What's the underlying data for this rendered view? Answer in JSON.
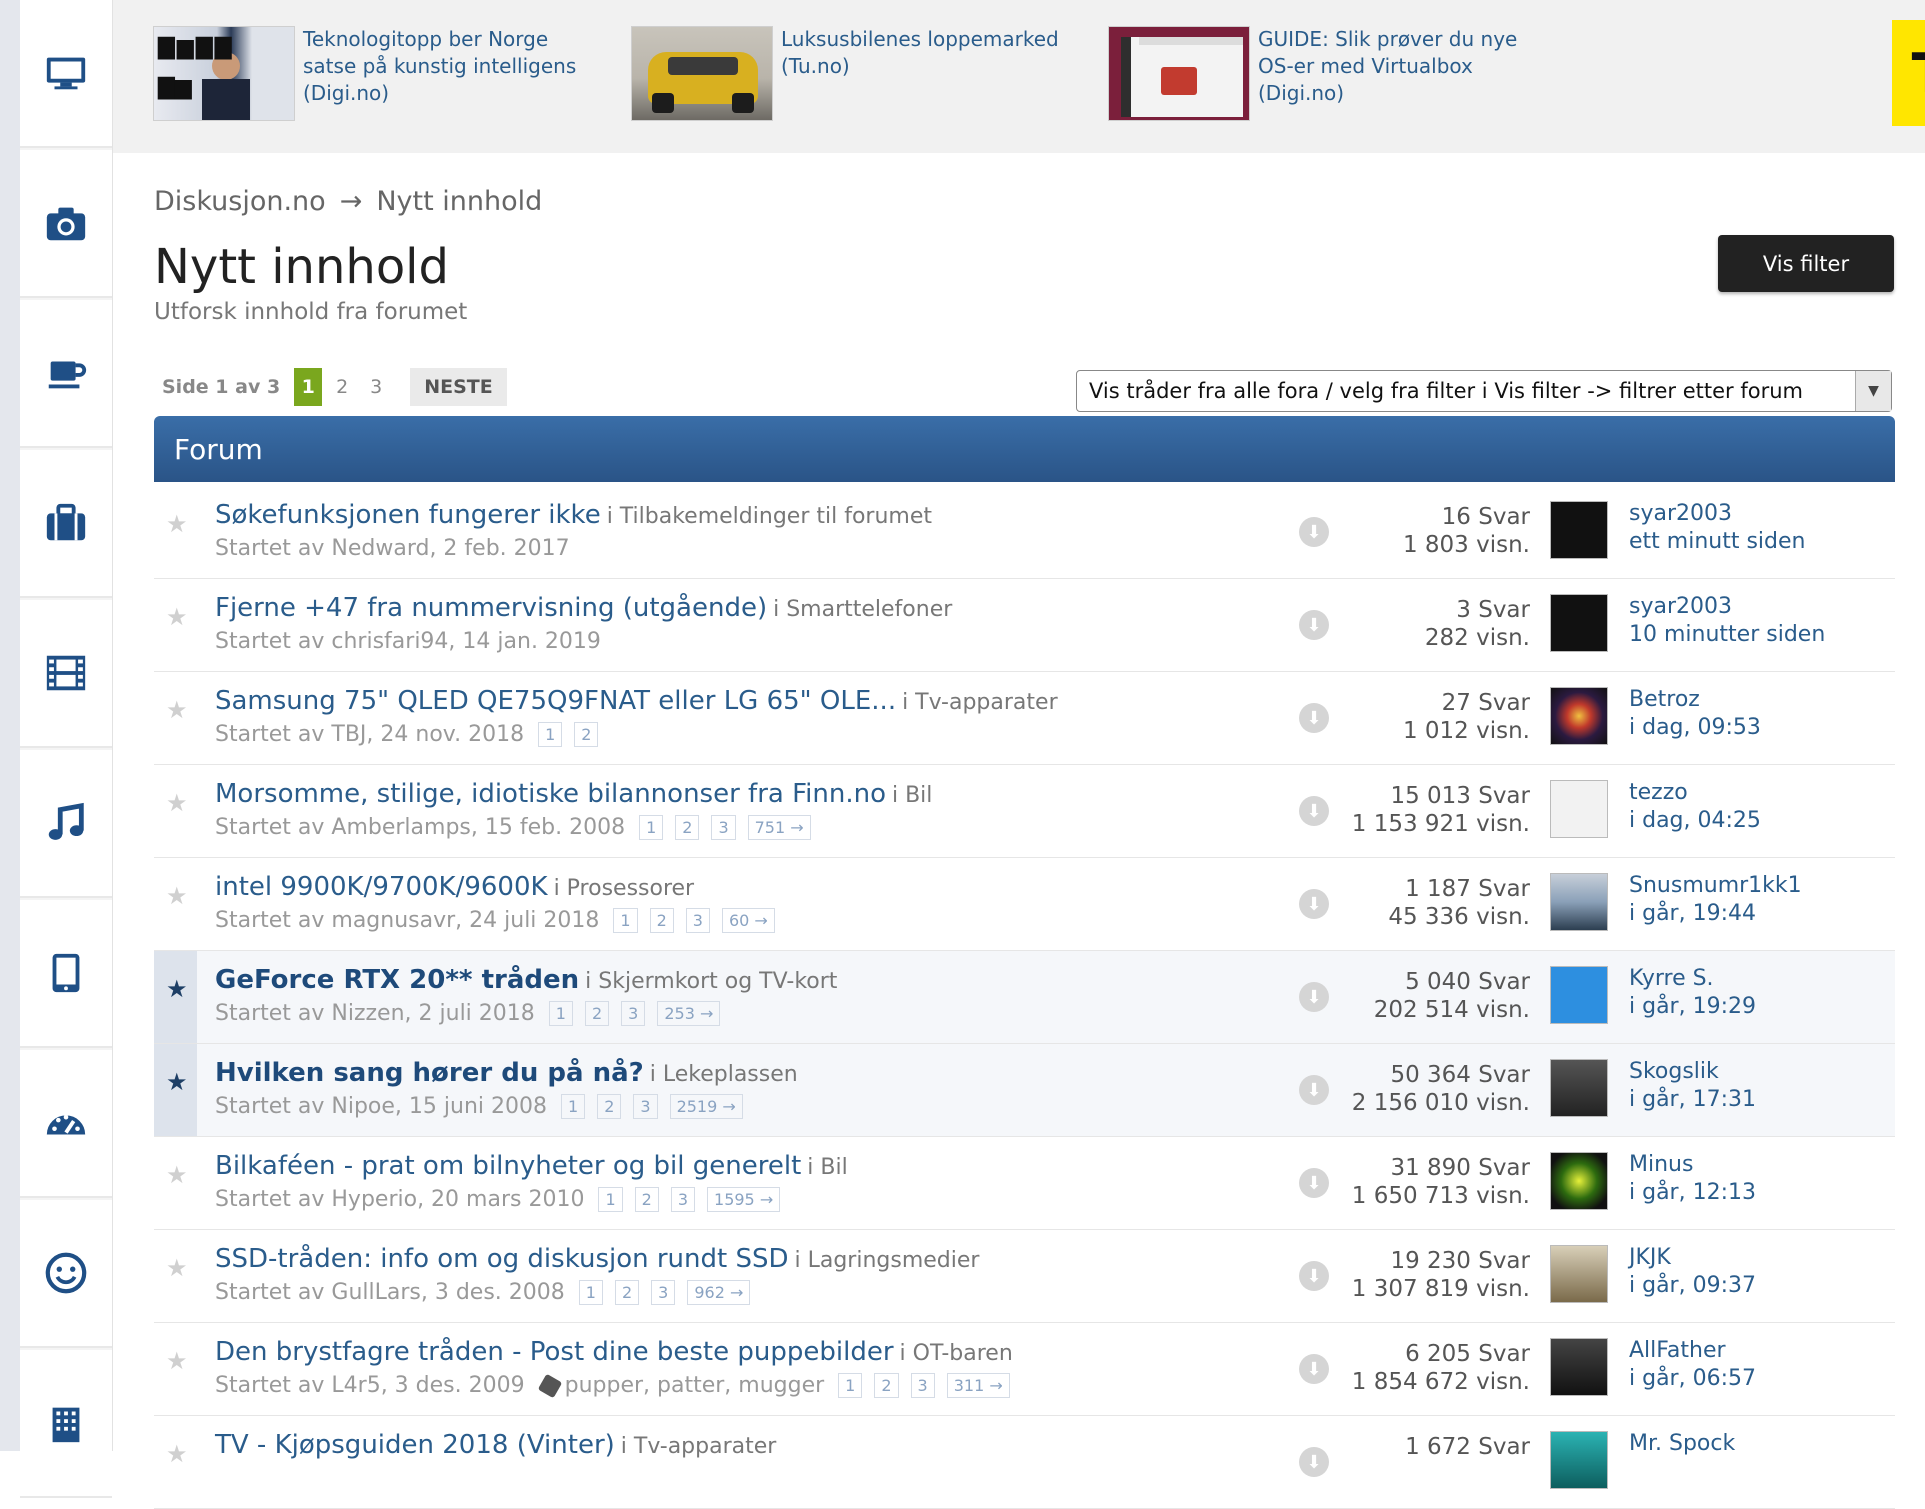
{
  "sidebar": {
    "items": [
      {
        "icon": "monitor-icon"
      },
      {
        "icon": "camera-icon"
      },
      {
        "icon": "coffee-icon"
      },
      {
        "icon": "briefcase-icon"
      },
      {
        "icon": "film-icon"
      },
      {
        "icon": "music-icon"
      },
      {
        "icon": "tablet-icon"
      },
      {
        "icon": "speedometer-icon"
      },
      {
        "icon": "smiley-icon"
      },
      {
        "icon": "building-icon"
      }
    ]
  },
  "ads": [
    {
      "text": "Teknologitopp ber Norge satse på kunstig intelligens (Digi.no)"
    },
    {
      "text": "Luksusbilenes loppemarked (Tu.no)"
    },
    {
      "text": "GUIDE: Slik prøver du nye OS-er med Virtualbox (Digi.no)"
    }
  ],
  "logo": {
    "text": "TU",
    "color": "#ffe600"
  },
  "breadcrumb": {
    "root": "Diskusjon.no",
    "sep": "→",
    "current": "Nytt innhold"
  },
  "page": {
    "title": "Nytt innhold",
    "subtitle": "Utforsk innhold fra forumet",
    "filter_button": "Vis filter"
  },
  "pager": {
    "label": "Side 1 av 3",
    "pages": [
      "1",
      "2",
      "3"
    ],
    "next": "NESTE"
  },
  "forum_select": {
    "value": "Vis tråder fra alle fora / velg fra filter i Vis filter -> filtrer etter forum"
  },
  "forum_header": "Forum",
  "topics": [
    {
      "title": "Søkefunksjonen fungerer ikke",
      "forum": "i Tilbakemeldinger til forumet",
      "started": "Startet av Nedward, 2 feb. 2017",
      "pages": [],
      "replies": "16 Svar",
      "views": "1 803 visn.",
      "user": "syar2003",
      "time": "ett minutt siden",
      "highlight": false
    },
    {
      "title": "Fjerne +47 fra nummervisning (utgående)",
      "forum": "i Smarttelefoner",
      "started": "Startet av chrisfari94, 14 jan. 2019",
      "pages": [],
      "replies": "3 Svar",
      "views": "282 visn.",
      "user": "syar2003",
      "time": "10 minutter siden",
      "highlight": false
    },
    {
      "title": "Samsung 75\" QLED QE75Q9FNAT eller LG 65\" OLE...",
      "forum": "i Tv-apparater",
      "started": "Startet av TBJ, 24 nov. 2018",
      "pages": [
        "1",
        "2"
      ],
      "replies": "27 Svar",
      "views": "1 012 visn.",
      "user": "Betroz",
      "time": "i dag, 09:53",
      "highlight": false
    },
    {
      "title": "Morsomme, stilige, idiotiske bilannonser fra Finn.no",
      "forum": "i Bil",
      "started": "Startet av Amberlamps, 15 feb. 2008",
      "pages": [
        "1",
        "2",
        "3",
        "751 →"
      ],
      "replies": "15 013 Svar",
      "views": "1 153 921 visn.",
      "user": "tezzo",
      "time": "i dag, 04:25",
      "highlight": false
    },
    {
      "title": "intel 9900K/9700K/9600K",
      "forum": "i Prosessorer",
      "started": "Startet av magnusavr, 24 juli 2018",
      "pages": [
        "1",
        "2",
        "3",
        "60 →"
      ],
      "replies": "1 187 Svar",
      "views": "45 336 visn.",
      "user": "Snusmumr1kk1",
      "time": "i går, 19:44",
      "highlight": false
    },
    {
      "title": "GeForce RTX 20** tråden",
      "forum": "i Skjermkort og TV-kort",
      "started": "Startet av Nizzen, 2 juli 2018",
      "pages": [
        "1",
        "2",
        "3",
        "253 →"
      ],
      "replies": "5 040 Svar",
      "views": "202 514 visn.",
      "user": "Kyrre S.",
      "time": "i går, 19:29",
      "highlight": true
    },
    {
      "title": "Hvilken sang hører du på nå?",
      "forum": "i Lekeplassen",
      "started": "Startet av Nipoe, 15 juni 2008",
      "pages": [
        "1",
        "2",
        "3",
        "2519 →"
      ],
      "replies": "50 364 Svar",
      "views": "2 156 010 visn.",
      "user": "Skogslik",
      "time": "i går, 17:31",
      "highlight": true
    },
    {
      "title": "Bilkaféen - prat om bilnyheter og bil generelt",
      "forum": "i Bil",
      "started": "Startet av Hyperio, 20 mars 2010",
      "pages": [
        "1",
        "2",
        "3",
        "1595 →"
      ],
      "replies": "31 890 Svar",
      "views": "1 650 713 visn.",
      "user": "Minus",
      "time": "i går, 12:13",
      "highlight": false
    },
    {
      "title": "SSD-tråden: info om og diskusjon rundt SSD",
      "forum": "i Lagringsmedier",
      "started": "Startet av GullLars, 3 des. 2008",
      "pages": [
        "1",
        "2",
        "3",
        "962 →"
      ],
      "replies": "19 230 Svar",
      "views": "1 307 819 visn.",
      "user": "JKJK",
      "time": "i går, 09:37",
      "highlight": false
    },
    {
      "title": "Den brystfagre tråden - Post dine beste puppebilder",
      "forum": "i OT-baren",
      "started": "Startet av L4r5, 3 des. 2009",
      "tags": "pupper, patter, mugger",
      "pages": [
        "1",
        "2",
        "3",
        "311 →"
      ],
      "replies": "6 205 Svar",
      "views": "1 854 672 visn.",
      "user": "AllFather",
      "time": "i går, 06:57",
      "highlight": false
    },
    {
      "title": "TV - Kjøpsguiden 2018 (Vinter)",
      "forum": "i Tv-apparater",
      "started": "",
      "pages": [],
      "replies": "1 672 Svar",
      "views": "",
      "user": "Mr. Spock",
      "time": "",
      "highlight": false
    }
  ]
}
